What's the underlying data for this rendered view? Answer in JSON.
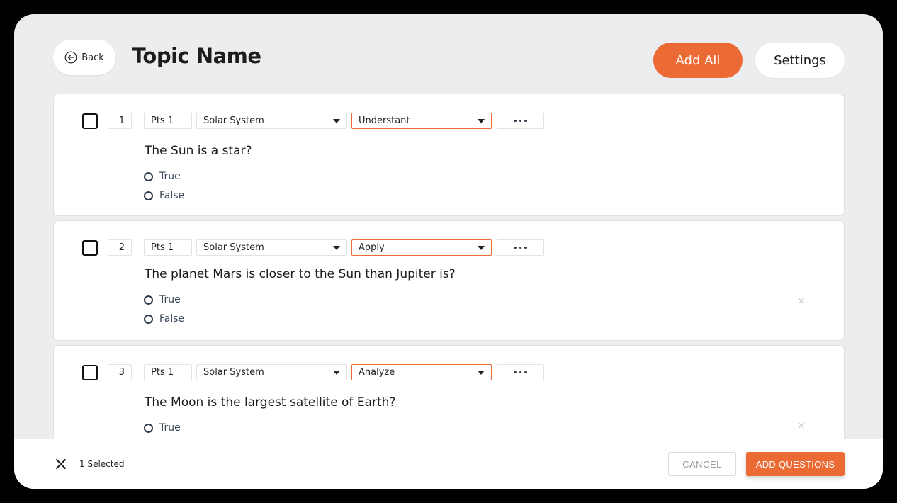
{
  "header": {
    "back_label": "Back",
    "title": "Topic Name",
    "add_all_label": "Add All",
    "settings_label": "Settings"
  },
  "colors": {
    "accent": "#ec6a33",
    "background": "#ecedef",
    "card": "#ffffff"
  },
  "questions": [
    {
      "number": "1",
      "points": "Pts 1",
      "topic": "Solar System",
      "level": "Understant",
      "more_icon": "ellipsis-icon",
      "text": "The Sun is a star?",
      "options": [
        "True",
        "False"
      ],
      "checked": false
    },
    {
      "number": "2",
      "points": "Pts 1",
      "topic": "Solar System",
      "level": "Apply",
      "more_icon": "ellipsis-icon",
      "text": "The planet Mars is closer to the Sun than Jupiter is?",
      "options": [
        "True",
        "False"
      ],
      "checked": false,
      "remove_icon": "close-icon"
    },
    {
      "number": "3",
      "points": "Pts 1",
      "topic": "Solar System",
      "level": "Analyze",
      "more_icon": "ellipsis-icon",
      "text": "The Moon is the largest satellite of Earth?",
      "options": [
        "True"
      ],
      "checked": false,
      "remove_icon": "close-icon"
    }
  ],
  "footer": {
    "remove_glyph": "×",
    "selected_count": "1 Selected",
    "cancel_label": "CANCEL",
    "add_questions_label": "ADD QUESTIONS"
  }
}
